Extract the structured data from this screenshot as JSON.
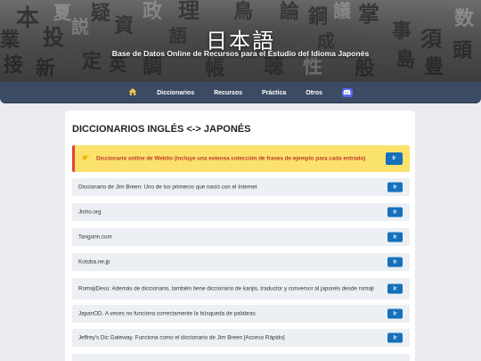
{
  "header": {
    "title": "日本語",
    "subtitle": "Base de Datos Online de Recursos para el Estudio del Idioma Japonés",
    "background_kanji": [
      "業",
      "本",
      "投",
      "説",
      "疑",
      "資",
      "政",
      "理",
      "論",
      "鋼",
      "議",
      "掌",
      "須",
      "事",
      "数",
      "接",
      "定",
      "調",
      "帳",
      "島",
      "豊",
      "新",
      "聴",
      "性",
      "般",
      "頭",
      "鳥",
      "英",
      "夏",
      "語",
      "成"
    ]
  },
  "nav": {
    "home_icon": "home-icon",
    "items": [
      "Diccionarios",
      "Recursos",
      "Práctica",
      "Otros"
    ],
    "discord_icon": "discord-icon"
  },
  "section": {
    "title": "DICCIONARIOS INGLÉS <-> JAPONÉS",
    "go_label": "Ir",
    "featured": {
      "icon": "pointing-hand-icon",
      "text": "Diccionario online de Weblio (incluye una extensa colección de frases de ejemplo para cada entrada)"
    },
    "entries": [
      "Diccionario de Jim Breen: Uno de los primeros que nació con el Internet",
      "Jisho.org",
      "Tangorin.com",
      "Kotoba.ne.jp",
      "RomajiDesu: Además de diccionario, también tiene diccionario de kanjis, traductor y conversor al japonés desde romaji",
      "JapanOD. A veces no funciona correctamente la búsqueda de palabras",
      "Jeffrey's Dic Gateway. Funciona como el diccionario de Jim Breen [Acceso Rápido]"
    ]
  },
  "colors": {
    "navbar": "#3b4b63",
    "button": "#1570bd",
    "featured_bg": "#fbe26d",
    "featured_text": "#c0392b",
    "entry_bg": "#eceff3"
  }
}
